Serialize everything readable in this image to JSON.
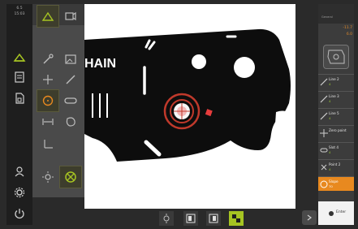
{
  "status": {
    "line1": "6.5",
    "line2": "15:03"
  },
  "main_menu": {
    "items": [
      {
        "name": "measure",
        "icon": "triangle-measure-icon",
        "active": true
      },
      {
        "name": "measure-report",
        "icon": "report-icon"
      },
      {
        "name": "file-management",
        "icon": "file-icon"
      },
      {
        "name": "user-login",
        "icon": "user-icon"
      },
      {
        "name": "settings",
        "icon": "gear-icon"
      },
      {
        "name": "switch-off",
        "icon": "power-icon"
      }
    ]
  },
  "palette": {
    "tools": [
      {
        "name": "measure-tools",
        "icon": "triangle-measure-icon",
        "active": true
      },
      {
        "name": "video-camera",
        "icon": "camera-icon"
      },
      {
        "name": "edge-probe",
        "icon": "pen-icon"
      },
      {
        "name": "image-icon-tool",
        "icon": "image-frame-icon"
      },
      {
        "name": "crosshair-tool",
        "icon": "crosshair-icon"
      },
      {
        "name": "line-tool",
        "icon": "line-icon"
      },
      {
        "name": "circle-tool",
        "icon": "circle-icon",
        "active": true
      },
      {
        "name": "slot-tool",
        "icon": "slot-icon"
      },
      {
        "name": "distance-tool",
        "icon": "distance-icon"
      },
      {
        "name": "blob-tool",
        "icon": "blob-icon"
      },
      {
        "name": "coordinate-tool",
        "icon": "axis-icon"
      },
      {
        "name": "brightness-tool",
        "icon": "sun-icon"
      },
      {
        "name": "auto-tool",
        "icon": "auto-icon",
        "active": true
      }
    ]
  },
  "workpiece": {
    "text": "HAIN"
  },
  "bottom_bar": {
    "buttons": [
      {
        "name": "light-settings",
        "icon": "light-icon"
      },
      {
        "name": "view-mode-1",
        "icon": "view-1-icon"
      },
      {
        "name": "view-mode-2",
        "icon": "view-2-icon"
      },
      {
        "name": "view-mode-3",
        "icon": "view-3-icon",
        "active": true
      }
    ]
  },
  "inspector": {
    "header": "General",
    "coord_x": "-11.7",
    "coord_y": "6.0",
    "features": [
      {
        "label": "Line 2",
        "sub": "4",
        "icon": "line-feature-icon"
      },
      {
        "label": "Line 3",
        "sub": "4",
        "icon": "line-feature-icon"
      },
      {
        "label": "Line 5",
        "sub": "4",
        "icon": "line-feature-icon"
      },
      {
        "label": "Zero point",
        "sub": "",
        "icon": "zero-point-icon"
      },
      {
        "label": "Slot 4",
        "sub": "4",
        "icon": "slot-feature-icon"
      },
      {
        "label": "Point 2",
        "sub": "4",
        "icon": "point-feature-icon"
      },
      {
        "label": "Slope",
        "sub": "70",
        "icon": "circle-feature-icon",
        "selected": true
      }
    ],
    "enter_label": "Enter"
  },
  "colors": {
    "accent_orange": "#e8891f",
    "accent_green": "#a6c422",
    "target_red": "#c0392b"
  }
}
